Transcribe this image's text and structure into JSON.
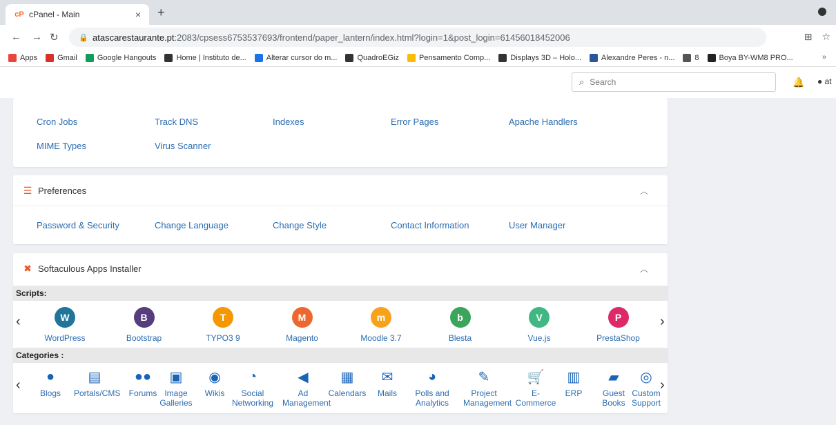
{
  "browser": {
    "tab_title": "cPanel - Main",
    "tab_close": "×",
    "new_tab": "+",
    "url_host": "atascarestaurante.pt",
    "url_rest": ":2083/cpsess6753537693/frontend/paper_lantern/index.html?login=1&post_login=61456018452006",
    "bookmarks": [
      {
        "label": "Apps",
        "color": "#e8453c"
      },
      {
        "label": "Gmail",
        "color": "#d93025"
      },
      {
        "label": "Google Hangouts",
        "color": "#0f9d58"
      },
      {
        "label": "Home | Instituto de...",
        "color": "#333333"
      },
      {
        "label": "Alterar cursor do m...",
        "color": "#1a73e8"
      },
      {
        "label": "QuadroEGiz",
        "color": "#333333"
      },
      {
        "label": "Pensamento Comp...",
        "color": "#fbbc04"
      },
      {
        "label": "Displays 3D – Holo...",
        "color": "#333333"
      },
      {
        "label": "Alexandre Peres - n...",
        "color": "#2b579a"
      },
      {
        "label": "8",
        "color": "#555555"
      },
      {
        "label": "Boya BY-WM8 PRO...",
        "color": "#222222"
      }
    ],
    "bookmarks_more": "»"
  },
  "header": {
    "search_placeholder": "Search",
    "user_label": "at"
  },
  "top_panel": {
    "links": [
      "Cron Jobs",
      "Track DNS",
      "Indexes",
      "Error Pages",
      "Apache Handlers",
      "MIME Types",
      "Virus Scanner"
    ]
  },
  "preferences": {
    "title": "Preferences",
    "links": [
      "Password & Security",
      "Change Language",
      "Change Style",
      "Contact Information",
      "User Manager"
    ]
  },
  "softaculous": {
    "title": "Softaculous Apps Installer",
    "scripts_label": "Scripts:",
    "categories_label": "Categories :",
    "scripts": [
      {
        "name": "WordPress",
        "icon": "wordpress-icon",
        "color": "#21759b",
        "glyph": "W"
      },
      {
        "name": "Bootstrap",
        "icon": "bootstrap-icon",
        "color": "#563d7c",
        "glyph": "B"
      },
      {
        "name": "TYPO3 9",
        "icon": "typo3-icon",
        "color": "#f49700",
        "glyph": "T"
      },
      {
        "name": "Magento",
        "icon": "magento-icon",
        "color": "#ee672f",
        "glyph": "M"
      },
      {
        "name": "Moodle 3.7",
        "icon": "moodle-icon",
        "color": "#f7a21b",
        "glyph": "m"
      },
      {
        "name": "Blesta",
        "icon": "blesta-icon",
        "color": "#3aa55b",
        "glyph": "b"
      },
      {
        "name": "Vue.js",
        "icon": "vuejs-icon",
        "color": "#41b883",
        "glyph": "V"
      },
      {
        "name": "PrestaShop",
        "icon": "prestashop-icon",
        "color": "#dd2968",
        "glyph": "P"
      }
    ],
    "categories": [
      {
        "name": "Blogs",
        "icon": "user-icon",
        "glyph": "●"
      },
      {
        "name": "Portals/CMS",
        "icon": "list-icon",
        "glyph": "▤"
      },
      {
        "name": "Forums",
        "icon": "users-icon",
        "glyph": "●●"
      },
      {
        "name": "Image Galleries",
        "icon": "image-icon",
        "glyph": "▣"
      },
      {
        "name": "Wikis",
        "icon": "globe-icon",
        "glyph": "◉"
      },
      {
        "name": "Social Networking",
        "icon": "chat-icon",
        "glyph": "◔"
      },
      {
        "name": "Ad Management",
        "icon": "megaphone-icon",
        "glyph": "◀"
      },
      {
        "name": "Calendars",
        "icon": "calendar-icon",
        "glyph": "▦"
      },
      {
        "name": "Mails",
        "icon": "mail-icon",
        "glyph": "✉"
      },
      {
        "name": "Polls and Analytics",
        "icon": "pie-chart-icon",
        "glyph": "◕"
      },
      {
        "name": "Project Management",
        "icon": "edit-icon",
        "glyph": "✎"
      },
      {
        "name": "E-Commerce",
        "icon": "cart-icon",
        "glyph": "🛒"
      },
      {
        "name": "ERP",
        "icon": "bar-chart-icon",
        "glyph": "▥"
      },
      {
        "name": "Guest Books",
        "icon": "book-icon",
        "glyph": "▰"
      },
      {
        "name": "Custom Support",
        "icon": "lifebuoy-icon",
        "glyph": "◎"
      }
    ]
  }
}
